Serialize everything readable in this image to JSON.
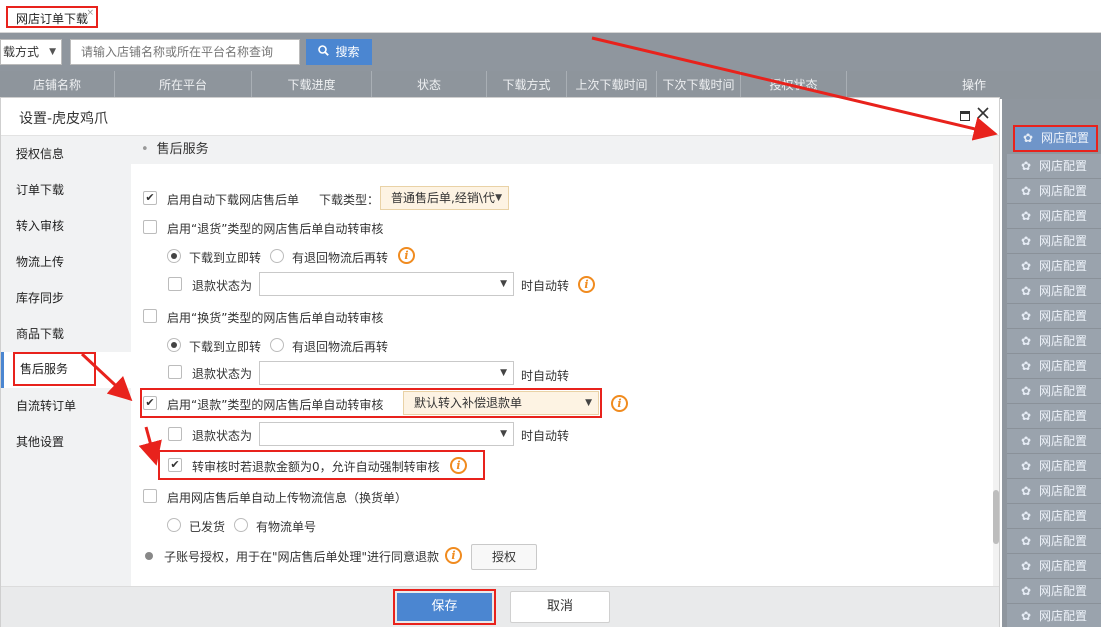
{
  "tab": {
    "title": "网店订单下载",
    "close": "×"
  },
  "toolbar": {
    "mode_select": "载方式",
    "search_placeholder": "请输入店铺名称或所在平台名称查询",
    "search_button": "搜索"
  },
  "table": {
    "columns": [
      "店铺名称",
      "所在平台",
      "下载进度",
      "状态",
      "下载方式",
      "上次下载时间",
      "下次下载时间",
      "授权状态",
      "操作"
    ],
    "row_action": "网店配置"
  },
  "modal": {
    "title": "设置-虎皮鸡爪",
    "nav": [
      "授权信息",
      "订单下载",
      "转入审核",
      "物流上传",
      "库存同步",
      "商品下载",
      "售后服务",
      "自流转订单",
      "其他设置"
    ],
    "section_title": "售后服务",
    "auto_download": {
      "label": "启用自动下载网店售后单",
      "checked": true,
      "type_label": "下载类型：",
      "type_value": "普通售后单,经销\\代"
    },
    "return_goods": {
      "label": "启用“退货”类型的网店售后单自动转审核",
      "checked": false,
      "radio_now": "下载到立即转",
      "radio_after": "有退回物流后再转",
      "refund_status_label": "退款状态为",
      "auto_suffix": "时自动转"
    },
    "exchange": {
      "label": "启用“换货”类型的网店售后单自动转审核",
      "checked": false,
      "radio_now": "下载到立即转",
      "radio_after": "有退回物流后再转",
      "refund_status_label": "退款状态为",
      "auto_suffix": "时自动转"
    },
    "refund": {
      "label": "启用“退款”类型的网店售后单自动转审核",
      "checked": true,
      "select_value": "默认转入补偿退款单",
      "refund_status_label": "退款状态为",
      "auto_suffix": "时自动转",
      "force_label": "转审核时若退款金额为0，允许自动强制转审核",
      "force_checked": true
    },
    "upload_logistics": {
      "label": "启用网店售后单自动上传物流信息（换货单）",
      "checked": false,
      "opt1": "已发货",
      "opt2": "有物流单号"
    },
    "sub_account": {
      "label": "子账号授权，用于在\"网店售后单处理\"进行同意退款",
      "button": "授权"
    },
    "footer": {
      "save": "保存",
      "cancel": "取消"
    },
    "info_glyph": "i"
  },
  "colors": {
    "accent": "#4b86d1",
    "highlight": "#e8221c",
    "info": "#f08b1f"
  }
}
